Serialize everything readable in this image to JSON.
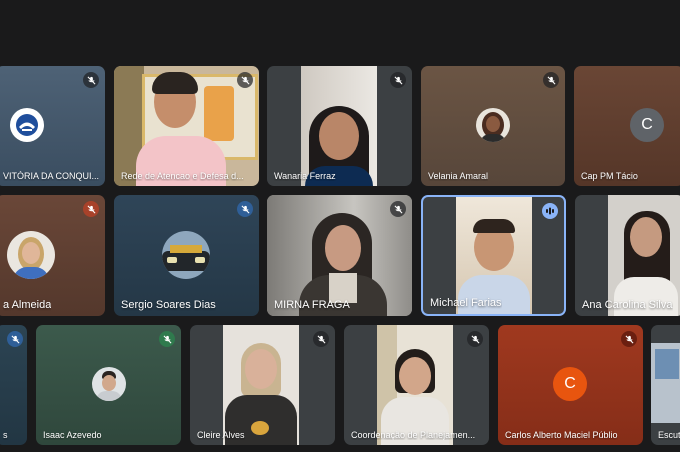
{
  "participants": [
    {
      "name": "VITÓRIA DA CONQUI...",
      "mic": "muted"
    },
    {
      "name": "Rede de Atencao e Defesa d...",
      "mic": "muted"
    },
    {
      "name": "Wanaria Ferraz",
      "mic": "muted"
    },
    {
      "name": "Velania Amaral",
      "mic": "muted"
    },
    {
      "name": "Cap PM Tácio",
      "mic": "none",
      "initial": "C"
    },
    {
      "name": "a Almeida",
      "mic": "muted"
    },
    {
      "name": "Sergio Soares Dias",
      "mic": "muted"
    },
    {
      "name": "MIRNA FRAGA",
      "mic": "muted"
    },
    {
      "name": "Michael Farias",
      "mic": "speaking"
    },
    {
      "name": "Ana Carolina Silva",
      "mic": "none"
    },
    {
      "name": "s",
      "mic": "muted"
    },
    {
      "name": "Isaac Azevedo",
      "mic": "muted"
    },
    {
      "name": "Cleire Alves",
      "mic": "muted"
    },
    {
      "name": "Coordenação de Planejamen...",
      "mic": "muted"
    },
    {
      "name": "Carlos Alberto Maciel Públio",
      "mic": "muted",
      "initial": "C"
    },
    {
      "name": "Escut",
      "mic": "none"
    }
  ],
  "colors": {
    "background": "#1a1a1b",
    "tile_gray": "#3c4043",
    "active_border": "#8ab4f8",
    "speaking_badge": "#8ab4f8",
    "avatar_cap": "#5f6368",
    "avatar_carlos": "#e8550f"
  }
}
